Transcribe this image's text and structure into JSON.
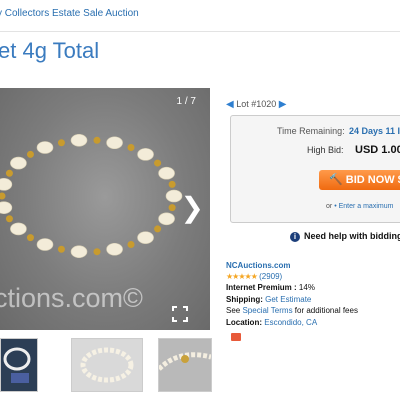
{
  "breadcrumb": "y Collectors Estate Sale Auction",
  "title": "et 4g Total",
  "gallery": {
    "counter": "1 / 7",
    "watermark": "ctions.com©",
    "next_icon": "chevron-right-icon",
    "expand_icon": "expand-icon"
  },
  "lot": {
    "label": "Lot #1020"
  },
  "bid": {
    "time_label": "Time Remaining:",
    "time_value": "24 Days 11 I",
    "high_label": "High Bid:",
    "high_value": "USD 1.00",
    "button_label": "BID NOW $2",
    "or": "or",
    "max_link": "• Enter a maximum"
  },
  "help": "Need help with bidding",
  "seller": {
    "name": "NCAuctions.com",
    "stars": "★★★★★",
    "rating": "(2909)",
    "premium_label": "Internet Premium :",
    "premium_value": "14%",
    "shipping_label": "Shipping:",
    "shipping_value": "Get Estimate",
    "see": "See",
    "terms_link": "Special Terms",
    "terms_rest": "for additional fees",
    "location_label": "Location:",
    "location_value": "Escondido, CA"
  }
}
